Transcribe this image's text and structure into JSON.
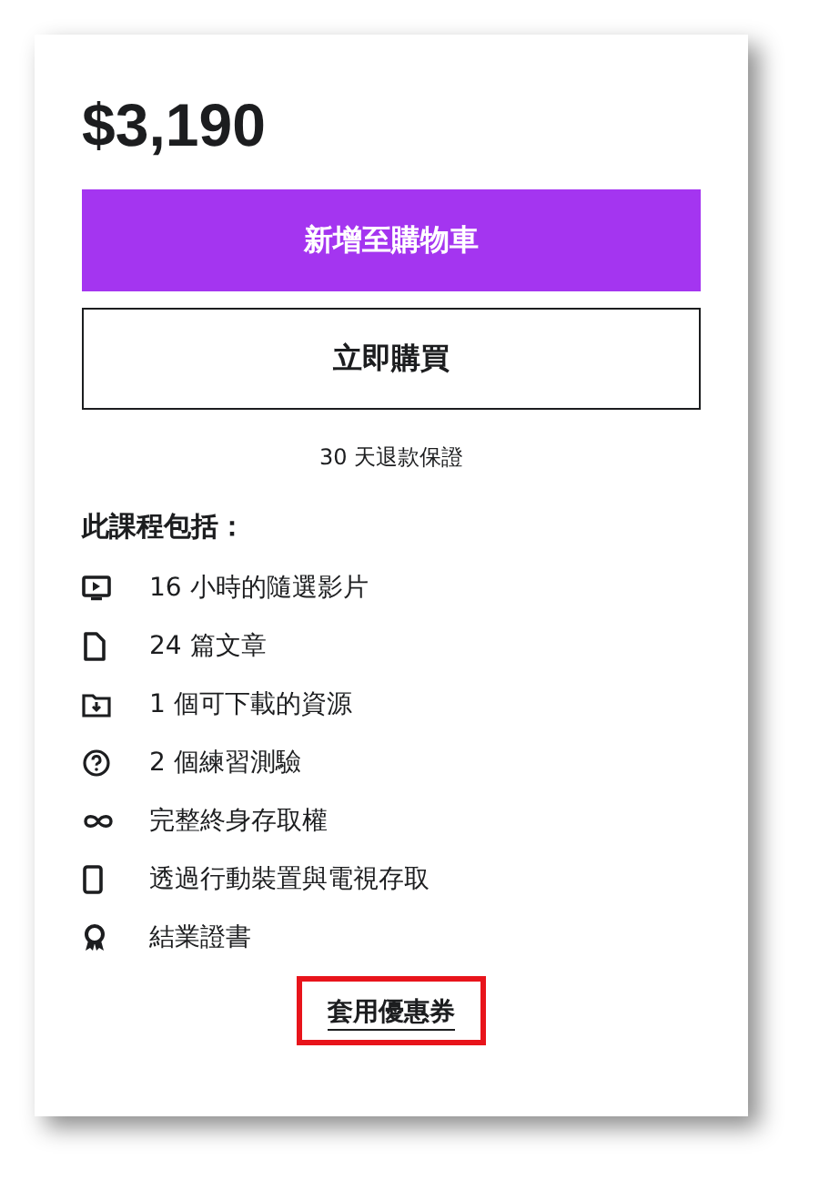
{
  "price": "$3,190",
  "add_to_cart": "新增至購物車",
  "buy_now": "立即購買",
  "guarantee": "30 天退款保證",
  "includes_title": "此課程包括：",
  "includes": [
    {
      "kind": "video",
      "text": "16 小時的隨選影片"
    },
    {
      "kind": "article",
      "text": "24 篇文章"
    },
    {
      "kind": "download",
      "text": "1 個可下載的資源"
    },
    {
      "kind": "quiz",
      "text": "2 個練習測驗"
    },
    {
      "kind": "access",
      "text": "完整終身存取權"
    },
    {
      "kind": "mobile",
      "text": "透過行動裝置與電視存取"
    },
    {
      "kind": "certificate",
      "text": "結業證書"
    }
  ],
  "coupon": {
    "text": "套用優惠券",
    "highlighted": true
  }
}
